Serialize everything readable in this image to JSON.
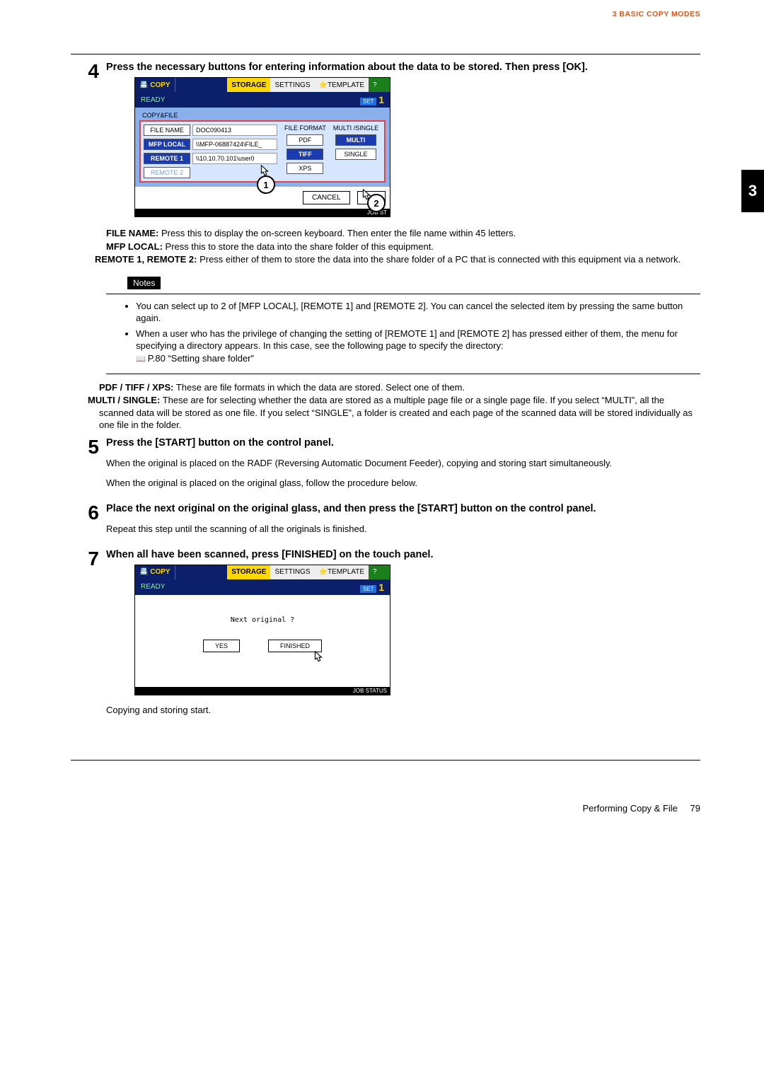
{
  "header": {
    "breadcrumb": "3 BASIC COPY MODES",
    "chapter_tab": "3"
  },
  "footer": {
    "section": "Performing Copy & File",
    "page": "79"
  },
  "steps": [
    {
      "num": "4",
      "title": "Press the necessary buttons for entering information about the data to be stored. Then press [OK]."
    },
    {
      "num": "5",
      "title": "Press the [START] button on the control panel.",
      "body1": "When the original is placed on the RADF (Reversing Automatic Document Feeder), copying and storing start simultaneously.",
      "body2": "When the original is placed on the original glass, follow the procedure below."
    },
    {
      "num": "6",
      "title": "Place the next original on the original glass, and then press the [START] button on the control panel.",
      "body1": "Repeat this step until the scanning of all the originals is finished."
    },
    {
      "num": "7",
      "title": "When all have been scanned, press [FINISHED] on the touch panel.",
      "body1": "Copying and storing start."
    }
  ],
  "panel1": {
    "tabs": {
      "copy": "COPY",
      "storage": "STORAGE",
      "settings": "SETTINGS",
      "template": "TEMPLATE",
      "help": "?"
    },
    "ready": "READY",
    "set_label": "SET",
    "set_num": "1",
    "sublabel": "COPY&FILE",
    "col_left": {
      "file_name_btn": "FILE NAME",
      "file_name_val": "DOC090413",
      "mfp_local_btn": "MFP LOCAL",
      "mfp_local_val": "\\\\MFP-06887424\\FILE_",
      "remote1_btn": "REMOTE 1",
      "remote1_val": "\\\\10.10.70.101\\user0",
      "remote2_btn": "REMOTE 2"
    },
    "col_mid_head": "FILE FORMAT",
    "formats": {
      "pdf": "PDF",
      "tiff": "TIFF",
      "xps": "XPS"
    },
    "col_right_head": "MULTI /SINGLE",
    "ms": {
      "multi": "MULTI",
      "single": "SINGLE"
    },
    "cancel": "CANCEL",
    "ok": "OK",
    "jobstatus": "JOB ST",
    "callout1": "1",
    "callout2": "2"
  },
  "defs": {
    "file_name_l": "FILE NAME:",
    "file_name_t": " Press this to display the on-screen keyboard. Then enter the file name within 45 letters.",
    "mfp_l": "MFP LOCAL:",
    "mfp_t": " Press this to store the data into the share folder of this equipment.",
    "remote_l": "REMOTE 1, REMOTE 2:",
    "remote_t": " Press either of them to store the data into the share folder of a PC that is connected with this equipment via a network."
  },
  "notes": {
    "label": "Notes",
    "n1": "You can select up to 2 of [MFP LOCAL], [REMOTE 1] and [REMOTE 2]. You can cancel the selected item by pressing the same button again.",
    "n2": "When a user who has the privilege of changing the setting of [REMOTE 1] and [REMOTE 2] has pressed either of them, the menu for specifying a directory appears. In this case, see the following page to specify the directory:",
    "ref": "P.80 “Setting share folder”"
  },
  "defs2": {
    "fmt_l": "PDF / TIFF / XPS:",
    "fmt_t": " These are file formats in which the data are stored. Select one of them.",
    "ms_l": "MULTI / SINGLE:",
    "ms_t": " These are for selecting whether the data are stored as a multiple page file or a single page file. If you select “MULTI”, all the scanned data will be stored as one file. If you select “SINGLE”, a folder is created and each page of the scanned data will be stored individually as one file in the folder."
  },
  "panel2": {
    "tabs": {
      "copy": "COPY",
      "storage": "STORAGE",
      "settings": "SETTINGS",
      "template": "TEMPLATE",
      "help": "?"
    },
    "ready": "READY",
    "set_label": "SET",
    "set_num": "1",
    "msg": "Next original ?",
    "yes": "YES",
    "finished": "FINISHED",
    "jobstatus": "JOB STATUS"
  }
}
